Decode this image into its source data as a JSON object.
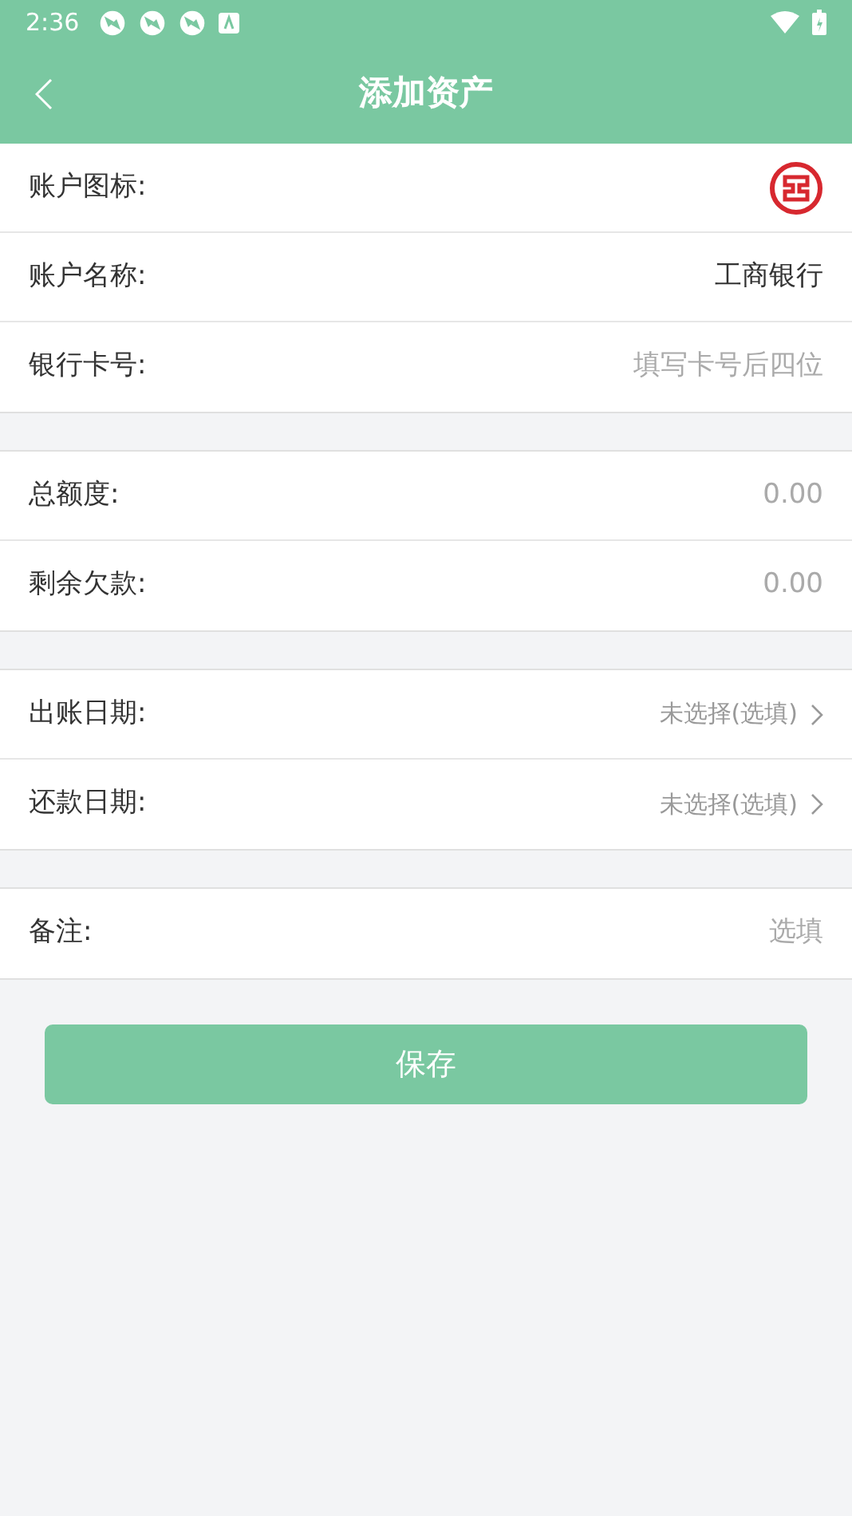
{
  "status_bar": {
    "time": "2:36"
  },
  "header": {
    "title": "添加资产"
  },
  "sections": [
    {
      "rows": [
        {
          "kind": "icon",
          "label": "账户图标:"
        },
        {
          "kind": "value",
          "label": "账户名称:",
          "value": "工商银行"
        },
        {
          "kind": "input",
          "label": "银行卡号:",
          "placeholder": "填写卡号后四位"
        }
      ]
    },
    {
      "rows": [
        {
          "kind": "input",
          "label": "总额度:",
          "placeholder": "0.00"
        },
        {
          "kind": "input",
          "label": "剩余欠款:",
          "placeholder": "0.00"
        }
      ]
    },
    {
      "rows": [
        {
          "kind": "select",
          "label": "出账日期:",
          "placeholder": "未选择(选填)"
        },
        {
          "kind": "select",
          "label": "还款日期:",
          "placeholder": "未选择(选填)"
        }
      ]
    },
    {
      "rows": [
        {
          "kind": "input",
          "label": "备注:",
          "placeholder": "选填"
        }
      ]
    }
  ],
  "save_button": "保存"
}
